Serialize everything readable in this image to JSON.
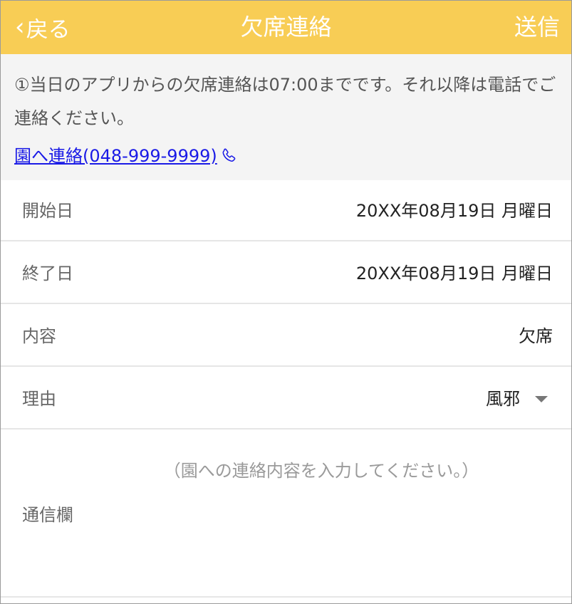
{
  "header": {
    "back_label": "戻る",
    "title": "欠席連絡",
    "send_label": "送信",
    "bg_color": "#f8cd55"
  },
  "notice": {
    "text": "①当日のアプリからの欠席連絡は07:00までです。それ以降は電話でご連絡ください。",
    "link_text": "園へ連絡(048-999-9999)",
    "link_icon": "phone-icon"
  },
  "form": {
    "rows": [
      {
        "label": "開始日",
        "value": "20XX年08月19日 月曜日"
      },
      {
        "label": "終了日",
        "value": "20XX年08月19日 月曜日"
      },
      {
        "label": "内容",
        "value": "欠席"
      },
      {
        "label": "理由",
        "value": "風邪",
        "has_dropdown": true
      }
    ],
    "message": {
      "label": "通信欄",
      "placeholder": "（園への連絡内容を入力してください。）",
      "value": ""
    }
  }
}
